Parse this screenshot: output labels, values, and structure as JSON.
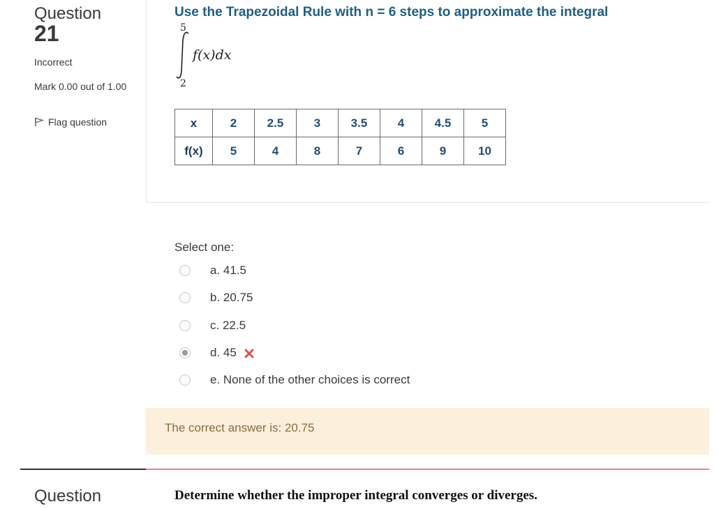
{
  "question": {
    "label": "Question",
    "number": "21",
    "state": "Incorrect",
    "grade": "Mark 0.00 out of 1.00",
    "flag_label": "Flag question",
    "text": "Use the Trapezoidal Rule with n = 6 steps to approximate the integral",
    "integral": {
      "upper": "5",
      "lower": "2",
      "expression": "f(x)dx"
    },
    "table": {
      "row1_header": "x",
      "row1": [
        "2",
        "2.5",
        "3",
        "3.5",
        "4",
        "4.5",
        "5"
      ],
      "row2_header": "f(x)",
      "row2": [
        "5",
        "4",
        "8",
        "7",
        "6",
        "9",
        "10"
      ]
    },
    "prompt": "Select one:",
    "options": [
      {
        "label": "a. 41.5",
        "checked": false
      },
      {
        "label": "b. 20.75",
        "checked": false
      },
      {
        "label": "c. 22.5",
        "checked": false
      },
      {
        "label": "d. 45",
        "checked": true,
        "mark": "incorrect-cross-icon"
      },
      {
        "label": "e. None of the other choices is correct",
        "checked": false
      }
    ],
    "feedback": "The correct answer is: 20.75"
  },
  "next_question": {
    "label": "Question",
    "text": "Determine whether the improper integral converges or diverges."
  },
  "colors": {
    "question_text": "#1f5f86",
    "feedback_bg": "#fcefdc",
    "feedback_text": "#8a6d3b",
    "incorrect_mark": "#d9534f",
    "separator_red": "#e8838c"
  }
}
